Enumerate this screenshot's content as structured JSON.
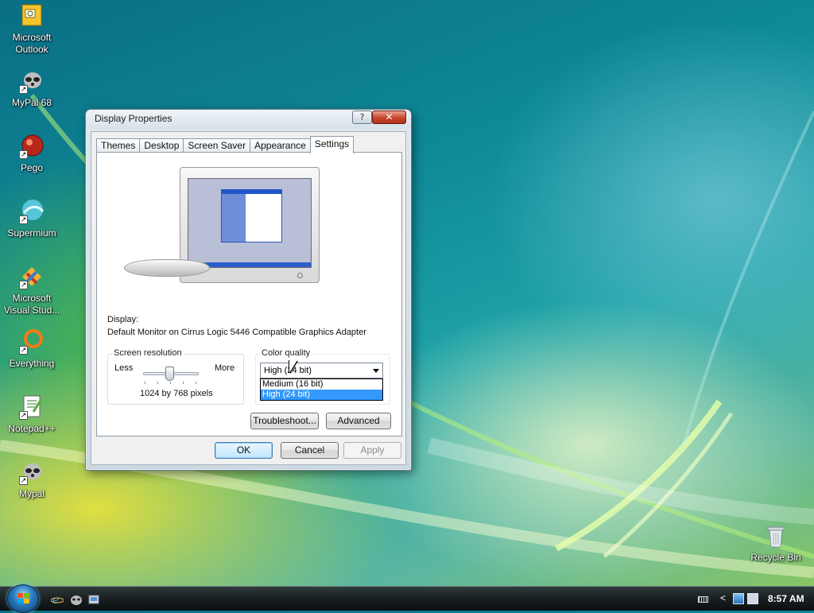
{
  "desktop": {
    "icons": [
      {
        "label": "Microsoft\nOutlook",
        "line1": "Microsoft",
        "line2": "Outlook"
      },
      {
        "line1": "MyPal 68",
        "line2": ""
      },
      {
        "line1": "Pego",
        "line2": ""
      },
      {
        "line1": "Supermium",
        "line2": ""
      },
      {
        "line1": "Microsoft",
        "line2": "Visual Stud..."
      },
      {
        "line1": "Everything",
        "line2": ""
      },
      {
        "line1": "Notepad++",
        "line2": ""
      },
      {
        "line1": "Mypal",
        "line2": ""
      },
      {
        "line1": "Recycle Bin",
        "line2": ""
      }
    ]
  },
  "window": {
    "title": "Display Properties",
    "help_label": "?",
    "close_label": "✕",
    "tabs": [
      "Themes",
      "Desktop",
      "Screen Saver",
      "Appearance",
      "Settings"
    ],
    "active_tab": "Settings",
    "display_label": "Display:",
    "display_value": "Default Monitor on Cirrus Logic 5446 Compatible Graphics Adapter",
    "screen_resolution": {
      "label": "Screen resolution",
      "less": "Less",
      "more": "More",
      "value_text": "1024 by 768 pixels",
      "slider_fraction": 0.5
    },
    "color_quality": {
      "label": "Color quality",
      "selected": "High (24 bit)",
      "options": [
        "Medium (16 bit)",
        "High (24 bit)"
      ]
    },
    "troubleshoot_label": "Troubleshoot...",
    "advanced_label": "Advanced",
    "ok_label": "OK",
    "cancel_label": "Cancel",
    "apply_label": "Apply"
  },
  "taskbar": {
    "clock": "8:57 AM",
    "tray_arrow": "<"
  },
  "colors": {
    "selection": "#3399ff",
    "close_button": "#c8452b",
    "taskbar": "#1b2223"
  }
}
